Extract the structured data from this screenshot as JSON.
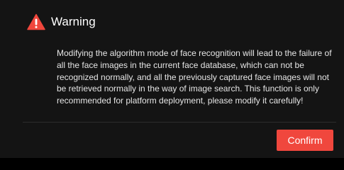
{
  "dialog": {
    "title": "Warning",
    "icon": "warning-triangle-icon",
    "message": "Modifying the algorithm mode of face recognition will lead to the failure of all the face images in the current face database, which can not be recognized normally, and all the previously captured face images will not be retrieved normally in the way of image search. This function is only recommended for platform deployment, please modify it carefully!",
    "confirm_label": "Confirm"
  },
  "colors": {
    "background": "#141414",
    "accent": "#f0473d",
    "text": "#ffffff"
  }
}
